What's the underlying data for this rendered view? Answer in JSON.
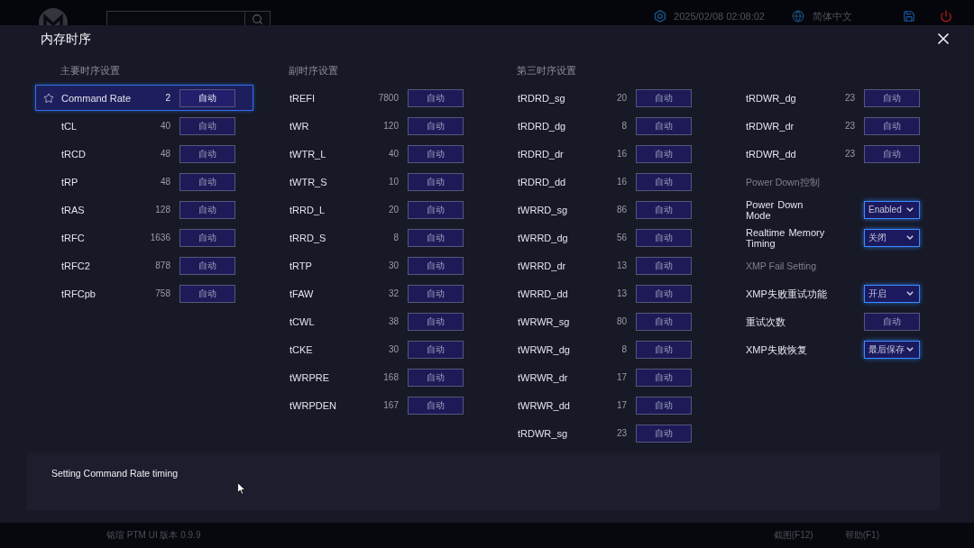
{
  "top_bar": {
    "datetime": "2025/02/08 02:08:02",
    "language": "简体中文"
  },
  "dialog": {
    "title": "内存时序",
    "columns": [
      {
        "heading": "主要时序设置",
        "items": [
          {
            "kind": "timing",
            "label": "Command Rate",
            "value": "2",
            "button": "自动",
            "selected": true
          },
          {
            "kind": "timing",
            "label": "tCL",
            "value": "40",
            "button": "自动",
            "selected": false
          },
          {
            "kind": "timing",
            "label": "tRCD",
            "value": "48",
            "button": "自动",
            "selected": false
          },
          {
            "kind": "timing",
            "label": "tRP",
            "value": "48",
            "button": "自动",
            "selected": false
          },
          {
            "kind": "timing",
            "label": "tRAS",
            "value": "128",
            "button": "自动",
            "selected": false
          },
          {
            "kind": "timing",
            "label": "tRFC",
            "value": "1636",
            "button": "自动",
            "selected": false
          },
          {
            "kind": "timing",
            "label": "tRFC2",
            "value": "878",
            "button": "自动",
            "selected": false
          },
          {
            "kind": "timing",
            "label": "tRFCpb",
            "value": "758",
            "button": "自动",
            "selected": false
          }
        ]
      },
      {
        "heading": "副时序设置",
        "items": [
          {
            "kind": "timing",
            "label": "tREFI",
            "value": "7800",
            "button": "自动",
            "selected": false
          },
          {
            "kind": "timing",
            "label": "tWR",
            "value": "120",
            "button": "自动",
            "selected": false
          },
          {
            "kind": "timing",
            "label": "tWTR_L",
            "value": "40",
            "button": "自动",
            "selected": false
          },
          {
            "kind": "timing",
            "label": "tWTR_S",
            "value": "10",
            "button": "自动",
            "selected": false
          },
          {
            "kind": "timing",
            "label": "tRRD_L",
            "value": "20",
            "button": "自动",
            "selected": false
          },
          {
            "kind": "timing",
            "label": "tRRD_S",
            "value": "8",
            "button": "自动",
            "selected": false
          },
          {
            "kind": "timing",
            "label": "tRTP",
            "value": "30",
            "button": "自动",
            "selected": false
          },
          {
            "kind": "timing",
            "label": "tFAW",
            "value": "32",
            "button": "自动",
            "selected": false
          },
          {
            "kind": "timing",
            "label": "tCWL",
            "value": "38",
            "button": "自动",
            "selected": false
          },
          {
            "kind": "timing",
            "label": "tCKE",
            "value": "30",
            "button": "自动",
            "selected": false
          },
          {
            "kind": "timing",
            "label": "tWRPRE",
            "value": "168",
            "button": "自动",
            "selected": false
          },
          {
            "kind": "timing",
            "label": "tWRPDEN",
            "value": "167",
            "button": "自动",
            "selected": false
          }
        ]
      },
      {
        "heading": "第三时序设置",
        "items": [
          {
            "kind": "timing",
            "label": "tRDRD_sg",
            "value": "20",
            "button": "自动",
            "selected": false
          },
          {
            "kind": "timing",
            "label": "tRDRD_dg",
            "value": "8",
            "button": "自动",
            "selected": false
          },
          {
            "kind": "timing",
            "label": "tRDRD_dr",
            "value": "16",
            "button": "自动",
            "selected": false
          },
          {
            "kind": "timing",
            "label": "tRDRD_dd",
            "value": "16",
            "button": "自动",
            "selected": false
          },
          {
            "kind": "timing",
            "label": "tWRRD_sg",
            "value": "86",
            "button": "自动",
            "selected": false
          },
          {
            "kind": "timing",
            "label": "tWRRD_dg",
            "value": "56",
            "button": "自动",
            "selected": false
          },
          {
            "kind": "timing",
            "label": "tWRRD_dr",
            "value": "13",
            "button": "自动",
            "selected": false
          },
          {
            "kind": "timing",
            "label": "tWRRD_dd",
            "value": "13",
            "button": "自动",
            "selected": false
          },
          {
            "kind": "timing",
            "label": "tWRWR_sg",
            "value": "80",
            "button": "自动",
            "selected": false
          },
          {
            "kind": "timing",
            "label": "tWRWR_dg",
            "value": "8",
            "button": "自动",
            "selected": false
          },
          {
            "kind": "timing",
            "label": "tWRWR_dr",
            "value": "17",
            "button": "自动",
            "selected": false
          },
          {
            "kind": "timing",
            "label": "tWRWR_dd",
            "value": "17",
            "button": "自动",
            "selected": false
          },
          {
            "kind": "timing",
            "label": "tRDWR_sg",
            "value": "23",
            "button": "自动",
            "selected": false
          }
        ]
      },
      {
        "items": [
          {
            "kind": "timing",
            "label": "tRDWR_dg",
            "value": "23",
            "button": "自动",
            "selected": false
          },
          {
            "kind": "timing",
            "label": "tRDWR_dr",
            "value": "23",
            "button": "自动",
            "selected": false
          },
          {
            "kind": "timing",
            "label": "tRDWR_dd",
            "value": "23",
            "button": "自动",
            "selected": false
          },
          {
            "kind": "section",
            "label": "Power Down控制"
          },
          {
            "kind": "select",
            "label": "Power Down Mode",
            "option": "Enabled",
            "selected": false
          },
          {
            "kind": "select",
            "label": "Realtime Memory Timing",
            "option": "关闭",
            "selected": false
          },
          {
            "kind": "section",
            "label": "XMP Fail Setting"
          },
          {
            "kind": "select",
            "label": "XMP失败重试功能",
            "option": "开启",
            "selected": false
          },
          {
            "kind": "button",
            "label": "重试次数",
            "button": "自动",
            "selected": false
          },
          {
            "kind": "select",
            "label": "XMP失败恢复",
            "option": "最后保存",
            "selected": false
          }
        ]
      }
    ],
    "description": "Setting Command Rate timing"
  },
  "footer": {
    "version": "铭瑄 PTM UI 版本 0.9.9",
    "shortcuts": [
      "截图(F12)",
      "帮助(F1)"
    ]
  }
}
